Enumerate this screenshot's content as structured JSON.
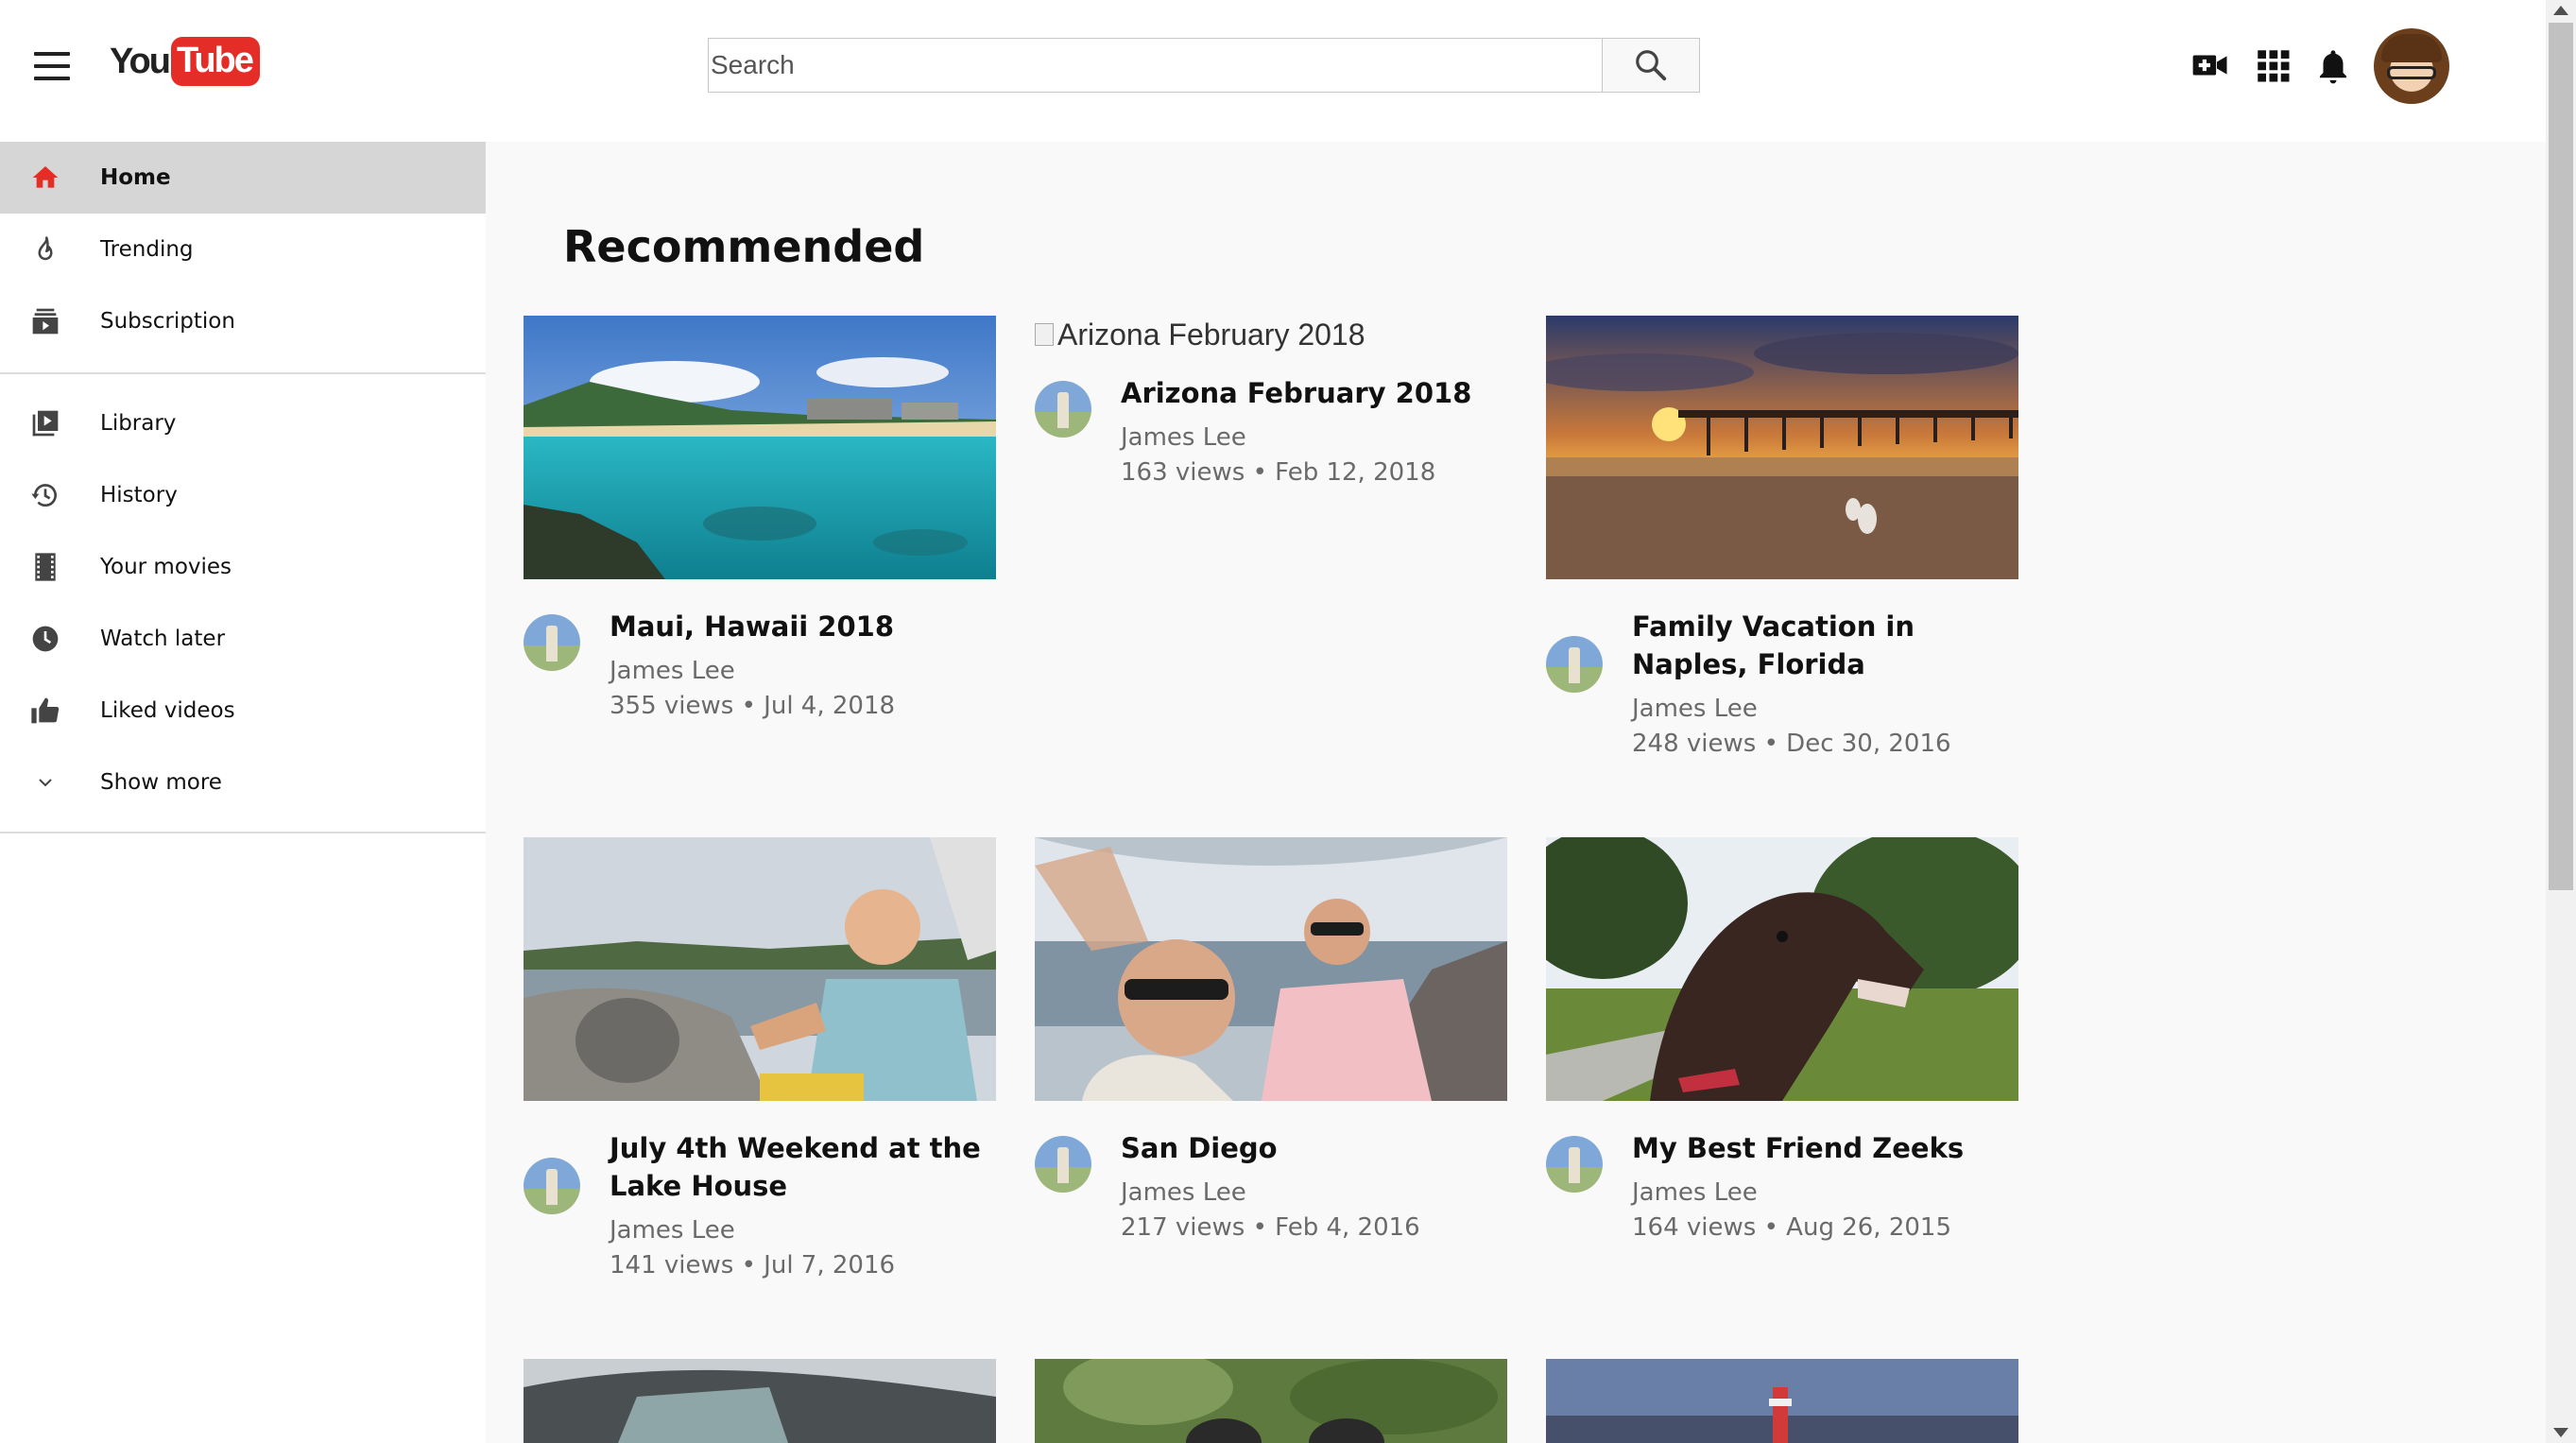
{
  "header": {
    "logo_you": "You",
    "logo_tube": "Tube",
    "search_placeholder": "Search"
  },
  "icons": {
    "menu": "hamburger-menu-icon",
    "search": "search-icon",
    "create": "video-camera-add-icon",
    "apps": "apps-grid-icon",
    "notifications": "bell-icon",
    "account": "user-avatar"
  },
  "colors": {
    "brand_red": "#e52d27",
    "active_item_bg": "#d6d6d6"
  },
  "sidebar": {
    "primary": [
      {
        "label": "Home",
        "icon": "home-icon",
        "active": true
      },
      {
        "label": "Trending",
        "icon": "fire-icon"
      },
      {
        "label": "Subscription",
        "icon": "subscriptions-icon"
      }
    ],
    "secondary": [
      {
        "label": "Library",
        "icon": "library-icon"
      },
      {
        "label": "History",
        "icon": "history-icon"
      },
      {
        "label": "Your movies",
        "icon": "film-icon"
      },
      {
        "label": "Watch later",
        "icon": "clock-icon"
      },
      {
        "label": "Liked videos",
        "icon": "thumbs-up-icon"
      },
      {
        "label": "Show more",
        "icon": "chevron-down-icon"
      }
    ]
  },
  "main": {
    "section_title": "Recommended",
    "videos": [
      {
        "title": "Maui, Hawaii 2018",
        "channel": "James Lee",
        "stats": "355 views • Jul 4, 2018"
      },
      {
        "title": "Arizona February 2018",
        "thumb_alt": "Arizona February 2018",
        "channel": "James Lee",
        "stats": "163 views • Feb 12, 2018"
      },
      {
        "title": "Family Vacation in Naples, Florida",
        "channel": "James Lee",
        "stats": "248 views • Dec 30, 2016"
      },
      {
        "title": "July 4th Weekend at the Lake House",
        "channel": "James Lee",
        "stats": "141 views • Jul 7, 2016"
      },
      {
        "title": "San Diego",
        "channel": "James Lee",
        "stats": "217 views • Feb 4, 2016"
      },
      {
        "title": "My Best Friend Zeeks",
        "channel": "James Lee",
        "stats": "164 views • Aug 26, 2015"
      }
    ]
  }
}
